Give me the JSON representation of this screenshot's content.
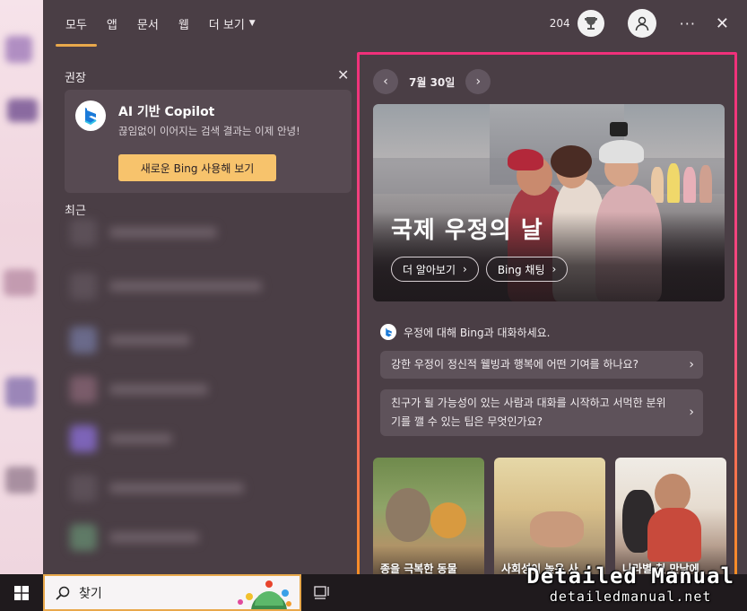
{
  "header": {
    "tabs": [
      {
        "label": "모두",
        "active": true
      },
      {
        "label": "앱"
      },
      {
        "label": "문서"
      },
      {
        "label": "웹"
      },
      {
        "label": "더 보기"
      }
    ],
    "points": "204",
    "trophy_icon": "trophy-icon",
    "avatar_icon": "person-icon",
    "more_label": "···",
    "close_label": "✕"
  },
  "recommended": {
    "title": "권장",
    "close_label": "✕",
    "card": {
      "title": "AI 기반 Copilot",
      "description": "끊임없이 이어지는 검색 결과는 이제 안녕!",
      "button": "새로운 Bing 사용해 보기"
    }
  },
  "recent": {
    "title": "최근"
  },
  "spotlight": {
    "date": "7월 30일",
    "prev_label": "‹",
    "next_label": "›",
    "hero_title": "국제 우정의 날",
    "learn_more": "더 알아보기",
    "bing_chat": "Bing 채팅",
    "chat_prompt": "우정에 대해 Bing과 대화하세요.",
    "suggestions": [
      "강한 우정이 정신적 웰빙과 행복에 어떤 기여를 하나요?",
      "친구가 될 가능성이 있는 사람과 대화를 시작하고 서먹한 분위기를 깰 수 있는 팁은 무엇인가요?"
    ],
    "thumbnails": [
      {
        "label": "종을 극복한 동물"
      },
      {
        "label": "사회성이 높은 사"
      },
      {
        "label": "나라별 첫 만남에"
      }
    ]
  },
  "taskbar": {
    "search_label": "찾기"
  },
  "watermark": {
    "line1": "Detailed Manual",
    "line2": "detailedmanual.net"
  },
  "colors": {
    "panel_bg": "#4a3e45",
    "accent": "#e8a84b",
    "highlight_border": "#f0307a"
  }
}
